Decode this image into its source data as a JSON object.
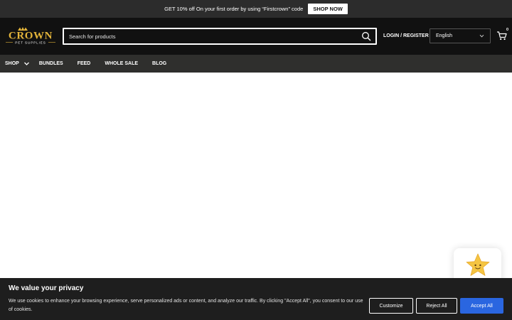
{
  "announcement": {
    "text": "GET 10% off On your first order by using “Firstcrown” code",
    "cta_label": "SHOP NOW"
  },
  "header": {
    "logo_text": "CROWN",
    "logo_subtext": "PET SUPPLIES",
    "search_placeholder": "Search for products",
    "login_label": "LOGIN / REGISTER",
    "language": "English",
    "cart_count": "0"
  },
  "nav": {
    "items": [
      {
        "label": "SHOP",
        "has_dropdown": true
      },
      {
        "label": "BUNDLES"
      },
      {
        "label": "FEED"
      },
      {
        "label": "WHOLE SALE"
      },
      {
        "label": "BLOG"
      }
    ]
  },
  "cookie_banner": {
    "title": "We value your privacy",
    "text": "We use cookies to enhance your browsing experience, serve personalized ads or content, and analyze our traffic. By clicking \"Accept All\", you consent to our use of cookies.",
    "customize_label": "Customize",
    "reject_label": "Reject All",
    "accept_label": "Accept All"
  },
  "icons": {
    "search": "search-icon",
    "cart": "cart-icon",
    "chevron": "chevron-down-icon",
    "review_widget": "star-icon"
  },
  "colors": {
    "header_bg": "#111111",
    "nav_bg": "#2f2f2d",
    "brand_gold": "#e3b43a",
    "accept_blue": "#2a66e0"
  }
}
